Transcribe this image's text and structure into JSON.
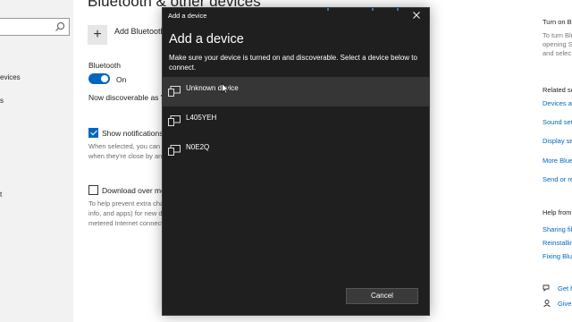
{
  "nav": {
    "items": [
      {
        "label": "evices"
      },
      {
        "label": "s"
      },
      {
        "label": "t"
      }
    ]
  },
  "main": {
    "title": "Bluetooth & other devices",
    "add_label": "Add Bluetooth or other device",
    "bluetooth_label": "Bluetooth",
    "toggle_state": "On",
    "discoverable": "Now discoverable as \"LAPTOP\"",
    "notifications_label": "Show notifications to connect using Swift Pair",
    "notifications_desc": [
      "When selected, you can connect to supported Bluetooth devices",
      "when they're close by and in pairing mode."
    ],
    "metered_label": "Download over metered connections",
    "metered_desc": [
      "To help prevent extra charges, keep this off so device software (drivers,",
      "info, and apps) for new devices won't download while you're on",
      "metered Internet connections."
    ]
  },
  "right": {
    "turn_on_head": "Turn on Bluetooth",
    "turn_on_desc": [
      "To turn Bluetooth",
      "opening S",
      "and selec"
    ],
    "related_head": "Related settings",
    "related_links": [
      "Devices and printers",
      "Sound settings",
      "Display settings",
      "More Bluetooth options",
      "Send or receive files"
    ],
    "help_head": "Help from the web",
    "help_links": [
      "Sharing files",
      "Reinstalling",
      "Fixing Bluetooth"
    ],
    "get_help": "Get help",
    "give_feedback": "Give feedback"
  },
  "dialog": {
    "caption": "Add a device",
    "title": "Add a device",
    "instructions": "Make sure your device is turned on and discoverable. Select a device below to connect.",
    "devices": [
      {
        "name": "Unknown device"
      },
      {
        "name": "L405YEH"
      },
      {
        "name": "N0E2Q"
      }
    ],
    "cancel_label": "Cancel"
  }
}
